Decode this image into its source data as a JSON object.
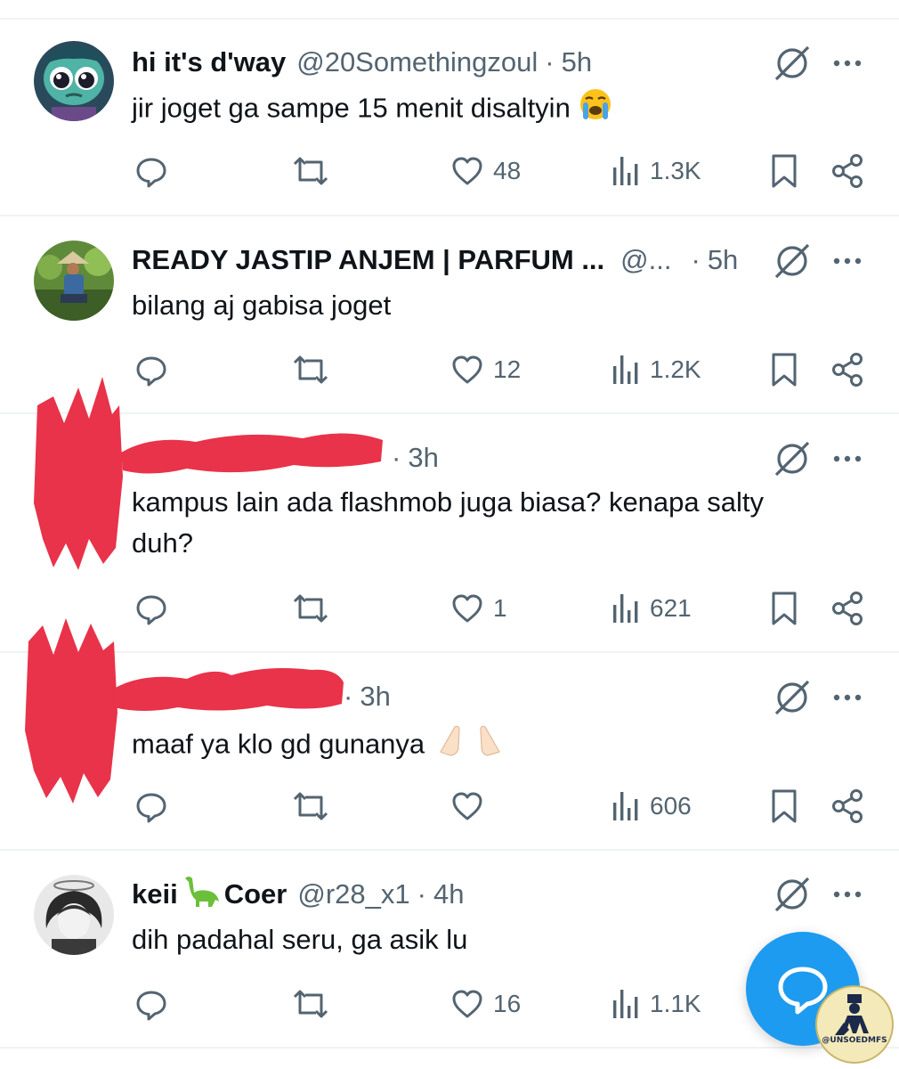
{
  "tweets": [
    {
      "display_name": "hi it's d'way",
      "handle": "@20Somethingzoul",
      "time": "5h",
      "text": "jir joget ga sampe 15 menit disaltyin",
      "emoji": "loudly-crying-face",
      "likes": "48",
      "views": "1.3K"
    },
    {
      "display_name": "READY JASTIP ANJEM | PARFUM ...",
      "handle": "@...",
      "time": "5h",
      "text": "bilang aj gabisa joget",
      "likes": "12",
      "views": "1.2K"
    },
    {
      "display_name": "",
      "handle": "",
      "time": "3h",
      "text_line1": "kampus lain ada flashmob juga biasa? kenapa salty",
      "text_line2": "duh?",
      "likes": "1",
      "views": "621"
    },
    {
      "display_name": "",
      "handle": "",
      "time": "3h",
      "text": "maaf ya klo gd gunanya",
      "emoji": "folded-hands",
      "likes": "",
      "views": "606"
    },
    {
      "display_name_prefix": "keii",
      "display_name_emoji": "sauropod",
      "display_name_suffix": "Coer",
      "handle": "@r28_x1",
      "time": "4h",
      "text": "dih padahal seru, ga asik lu",
      "likes": "16",
      "views": "1.1K"
    }
  ],
  "separator": "·",
  "icons": {
    "reply": "reply-icon",
    "retweet": "retweet-icon",
    "like": "heart-icon",
    "views": "views-icon",
    "bookmark": "bookmark-icon",
    "share": "share-icon",
    "grok": "grok-icon",
    "more": "more-icon",
    "compose": "compose-reply-icon"
  },
  "watermark": {
    "text": "@UNSOEDMFS"
  },
  "colors": {
    "accent": "#1d9bf0",
    "muted": "#536471",
    "text": "#0f1419",
    "redaction": "#e8334a"
  }
}
